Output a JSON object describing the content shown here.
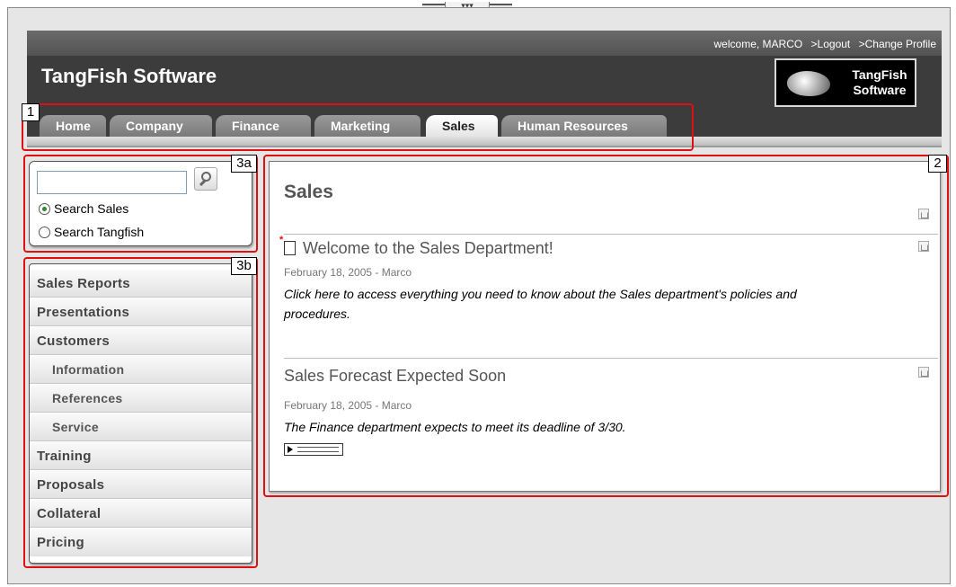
{
  "header": {
    "welcome": "welcome, MARCO",
    "logout": ">Logout",
    "change_profile": ">Change Profile",
    "title": "TangFish Software",
    "logo_line1": "TangFish",
    "logo_line2": "Software",
    "handle_label": "▾▾▾"
  },
  "tabs": [
    {
      "label": "Home",
      "active": false
    },
    {
      "label": "Company",
      "active": false
    },
    {
      "label": "Finance",
      "active": false
    },
    {
      "label": "Marketing",
      "active": false
    },
    {
      "label": "Sales",
      "active": true
    },
    {
      "label": "Human Resources",
      "active": false
    }
  ],
  "callouts": {
    "n1": "1",
    "n2": "2",
    "n3a": "3a",
    "n3b": "3b",
    "color": "#e01010"
  },
  "search": {
    "value": "",
    "placeholder": "",
    "options": [
      {
        "label": "Search Sales",
        "selected": true
      },
      {
        "label": "Search Tangfish",
        "selected": false
      }
    ]
  },
  "nav": {
    "items": [
      {
        "label": "Sales Reports",
        "sub": false
      },
      {
        "label": "Presentations",
        "sub": false
      },
      {
        "label": "Customers",
        "sub": false
      },
      {
        "label": "Information",
        "sub": true
      },
      {
        "label": "References",
        "sub": true
      },
      {
        "label": "Service",
        "sub": true
      },
      {
        "label": "Training",
        "sub": false
      },
      {
        "label": "Proposals",
        "sub": false
      },
      {
        "label": "Collateral",
        "sub": false
      },
      {
        "label": "Pricing",
        "sub": false
      }
    ]
  },
  "content": {
    "title": "Sales",
    "articles": [
      {
        "title": "Welcome to the Sales Department!",
        "meta": "February 18, 2005  -  Marco",
        "body": "Click here to access everything you need to know about the Sales department's policies and procedures.",
        "new_marker": "*"
      },
      {
        "title": "Sales Forecast Expected Soon",
        "meta": "February 18, 2005  -  Marco",
        "body": "The Finance department expects to meet its deadline of 3/30."
      }
    ]
  }
}
